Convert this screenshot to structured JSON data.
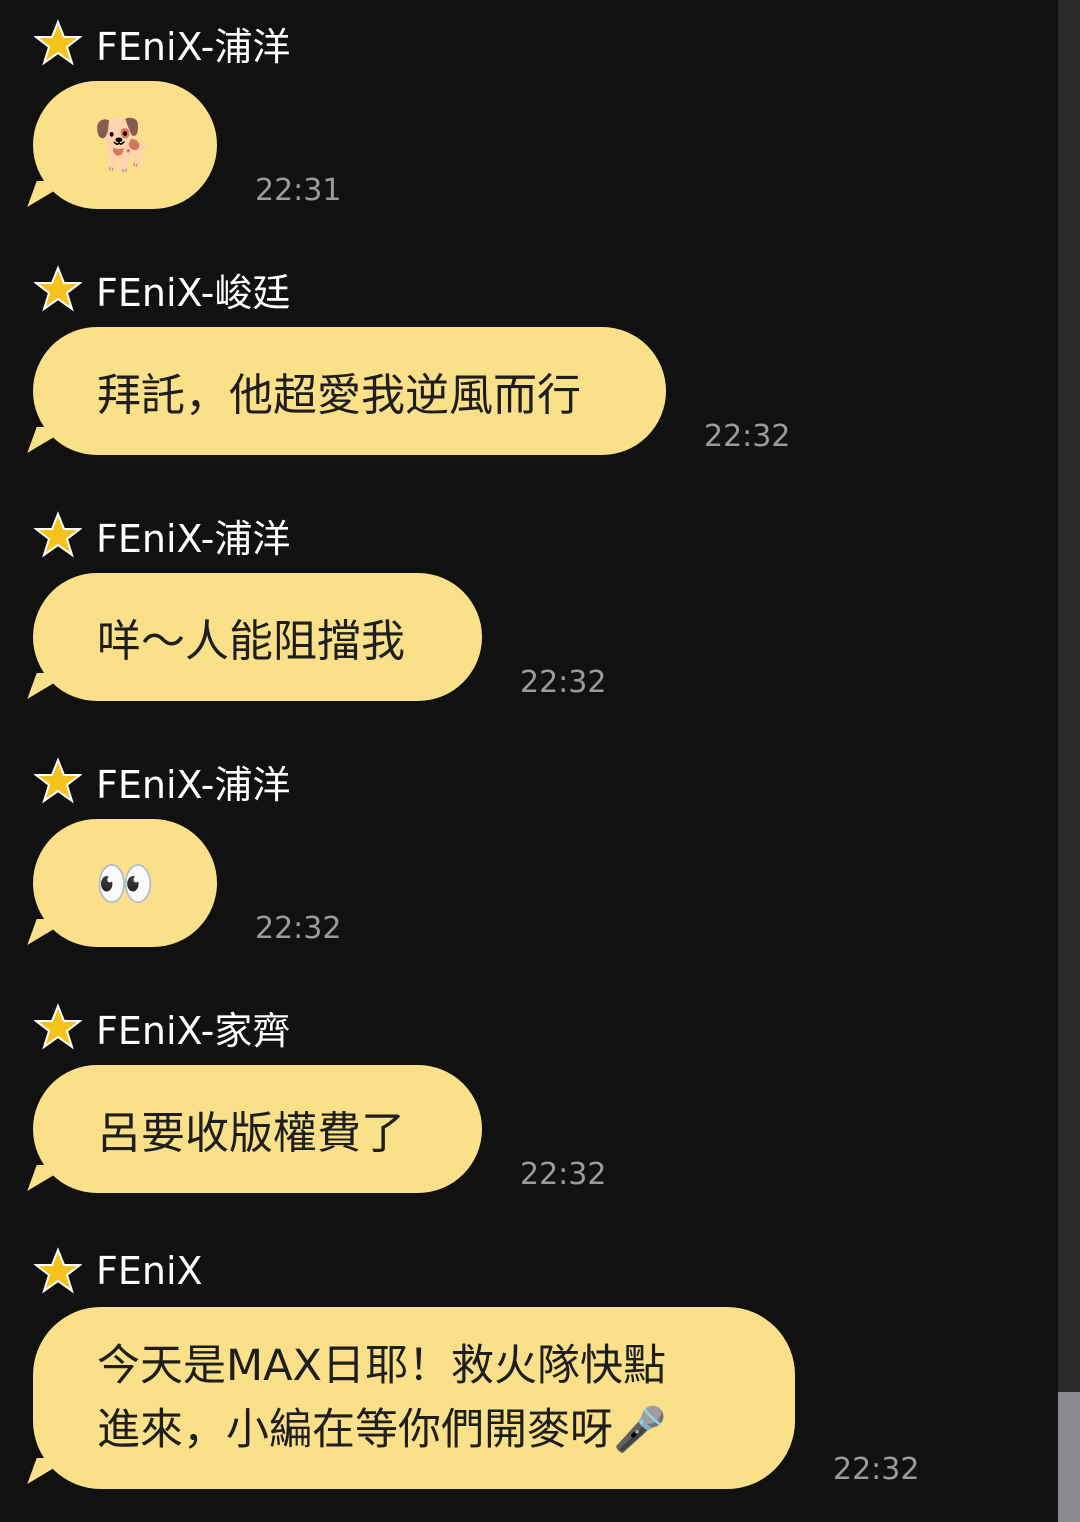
{
  "messages": [
    {
      "sender": "FEniX-浦洋",
      "text": "🐕",
      "time": "22:31"
    },
    {
      "sender": "FEniX-峻廷",
      "text": "拜託，他超愛我逆風而行",
      "time": "22:32"
    },
    {
      "sender": "FEniX-浦洋",
      "text": "咩～人能阻擋我",
      "time": "22:32"
    },
    {
      "sender": "FEniX-浦洋",
      "text": "👀",
      "time": "22:32"
    },
    {
      "sender": "FEniX-家齊",
      "text": "呂要收版權費了",
      "time": "22:32"
    },
    {
      "sender": "FEniX",
      "text_line1": "今天是MAX日耶！救火隊快點",
      "text_line2": "進來，小編在等你們開麥呀🎤",
      "time": "22:32"
    }
  ],
  "icons": {
    "sender_badge": "star-icon"
  },
  "colors": {
    "background": "#111112",
    "bubble": "#fbe08a",
    "star": "#f6c21c",
    "time_text": "#9b9b9b"
  }
}
